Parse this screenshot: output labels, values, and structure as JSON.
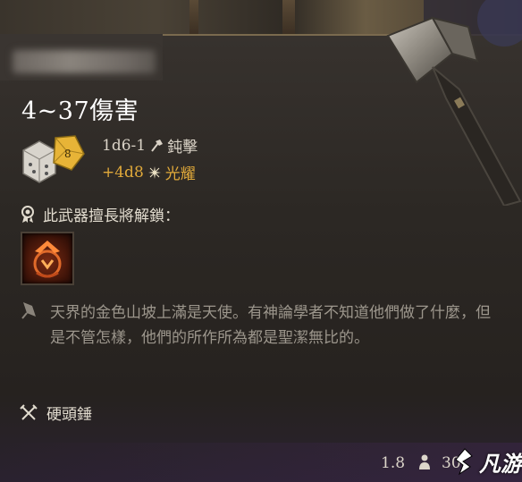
{
  "tooltip": {
    "item_name_obscured": "",
    "damage_title": "4~37傷害",
    "damage": [
      {
        "dice": "1d6-1",
        "icon": "hammer-strike-icon",
        "type": "鈍擊",
        "color": "#d9d2c6"
      },
      {
        "dice": "+4d8",
        "icon": "radiant-star-icon",
        "type": "光耀",
        "color": "#e0a93a"
      }
    ],
    "mastery_label": "此武器擅長將解鎖：",
    "mastery_icon": "ribbon-award-icon",
    "skill_icon": "skill-tile-icon",
    "flavor_text": "天界的金色山坡上滿是天使。有神論學者不知道他們做了什麼，但是不管怎樣，他們的所作所為都是聖潔無比的。",
    "weapon_type": "硬頭錘",
    "weight": "1.8",
    "value": "30",
    "watermark": "凡游"
  }
}
